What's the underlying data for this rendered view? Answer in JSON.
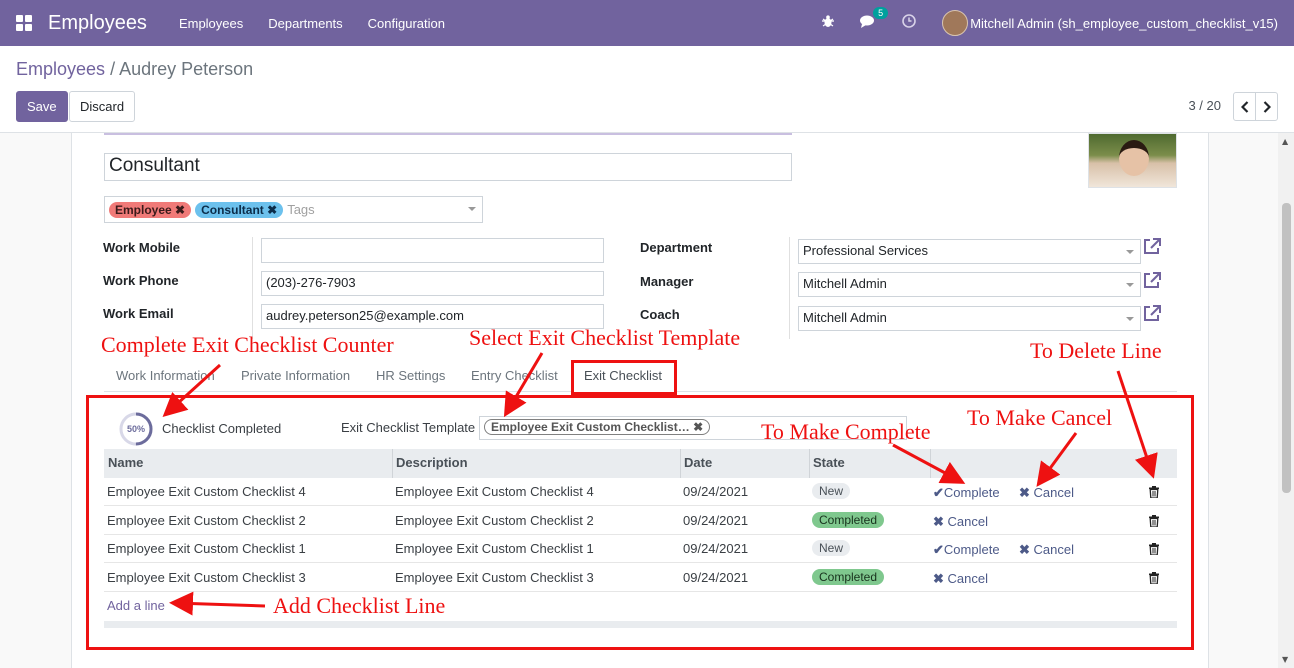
{
  "navbar": {
    "app_title": "Employees",
    "menu": [
      "Employees",
      "Departments",
      "Configuration"
    ],
    "chat_badge": "5",
    "user": "Mitchell Admin (sh_employee_custom_checklist_v15)"
  },
  "breadcrumb": {
    "parent": "Employees",
    "separator": "/",
    "current": "Audrey Peterson"
  },
  "buttons": {
    "save": "Save",
    "discard": "Discard"
  },
  "pager": {
    "text": "3 / 20"
  },
  "form": {
    "job_title": "Consultant",
    "tags": [
      "Employee",
      "Consultant"
    ],
    "tags_placeholder": "Tags",
    "left_fields": [
      {
        "label": "Work Mobile",
        "value": ""
      },
      {
        "label": "Work Phone",
        "value": "(203)-276-7903"
      },
      {
        "label": "Work Email",
        "value": "audrey.peterson25@example.com"
      }
    ],
    "right_fields": [
      {
        "label": "Department",
        "value": "Professional Services"
      },
      {
        "label": "Manager",
        "value": "Mitchell Admin"
      },
      {
        "label": "Coach",
        "value": "Mitchell Admin"
      }
    ]
  },
  "tabs": [
    "Work Information",
    "Private Information",
    "HR Settings",
    "Entry Checklist",
    "Exit Checklist"
  ],
  "active_tab": "Exit Checklist",
  "checklist": {
    "progress": "50%",
    "progress_fraction": 0.5,
    "completed_label": "Checklist Completed",
    "template_label": "Exit Checklist Template",
    "template_value": "Employee Exit Custom Checklist…",
    "columns": [
      "Name",
      "Description",
      "Date",
      "State"
    ],
    "rows": [
      {
        "name": "Employee Exit Custom Checklist 4",
        "description": "Employee Exit Custom Checklist 4",
        "date": "09/24/2021",
        "state": "New",
        "complete": "Complete",
        "cancel": "Cancel"
      },
      {
        "name": "Employee Exit Custom Checklist 2",
        "description": "Employee Exit Custom Checklist 2",
        "date": "09/24/2021",
        "state": "Completed",
        "complete": "",
        "cancel": "Cancel"
      },
      {
        "name": "Employee Exit Custom Checklist 1",
        "description": "Employee Exit Custom Checklist 1",
        "date": "09/24/2021",
        "state": "New",
        "complete": "Complete",
        "cancel": "Cancel"
      },
      {
        "name": "Employee Exit Custom Checklist 3",
        "description": "Employee Exit Custom Checklist 3",
        "date": "09/24/2021",
        "state": "Completed",
        "complete": "",
        "cancel": "Cancel"
      }
    ],
    "add_line": "Add a line"
  },
  "annotations": {
    "counter": "Complete Exit Checklist Counter",
    "template": "Select Exit Checklist Template",
    "delete": "To Delete Line",
    "cancel": "To Make Cancel",
    "complete": "To Make Complete",
    "add": "Add Checklist Line"
  },
  "colors": {
    "brand": "#71639e",
    "annotation": "#ee1111",
    "completed": "#7fc88e"
  }
}
